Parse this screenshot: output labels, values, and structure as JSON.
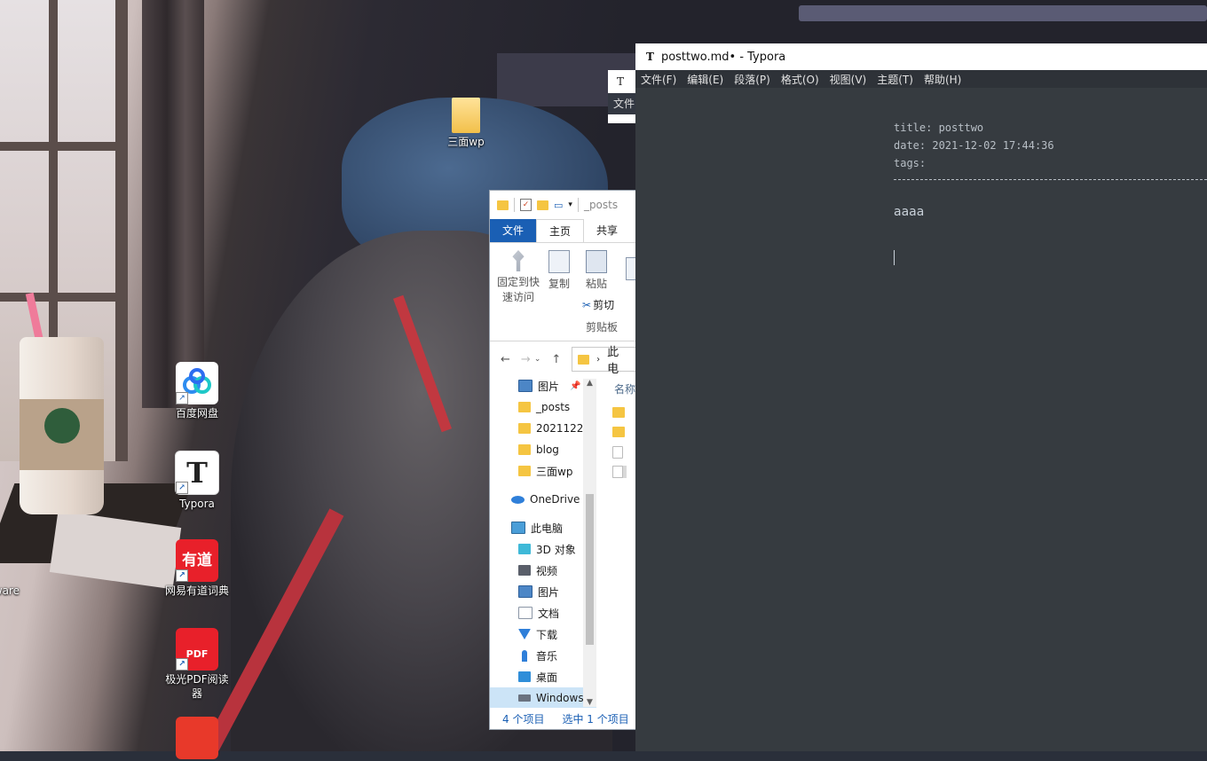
{
  "desktop": {
    "icons": [
      {
        "label": "三面wp",
        "icon": "folder-icon"
      },
      {
        "label": "百度网盘",
        "icon": "baidu-netdisk-icon"
      },
      {
        "label": "Typora",
        "icon": "typora-icon"
      },
      {
        "label": "网易有道词典",
        "icon": "youdao-dict-icon",
        "tile_text": "有道"
      },
      {
        "label": "极光PDF阅读器",
        "icon": "pdf-reader-icon",
        "tile_text": "PDF"
      },
      {
        "label": "ware",
        "icon": "app-icon"
      }
    ]
  },
  "bg_typora": {
    "logo": "T",
    "menu_label": "文件"
  },
  "explorer": {
    "quick_access_title": "_posts",
    "tabs": [
      "文件",
      "主页",
      "共享"
    ],
    "ribbon": {
      "pin_label_1": "固定到快",
      "pin_label_2": "速访问",
      "copy_label": "复制",
      "paste_label": "粘贴",
      "cut_label": "剪切",
      "group_label": "剪贴板"
    },
    "address_text": "此电",
    "nav_items": [
      {
        "label": "图片",
        "icon": "pictures-icon",
        "pinned": true
      },
      {
        "label": "_posts",
        "icon": "folder-icon"
      },
      {
        "label": "2021122",
        "icon": "folder-icon"
      },
      {
        "label": "blog",
        "icon": "folder-icon"
      },
      {
        "label": "三面wp",
        "icon": "folder-icon"
      },
      {
        "label": "OneDrive",
        "icon": "onedrive-icon"
      },
      {
        "label": "此电脑",
        "icon": "this-pc-icon"
      },
      {
        "label": "3D 对象",
        "icon": "3d-objects-icon"
      },
      {
        "label": "视频",
        "icon": "videos-icon"
      },
      {
        "label": "图片",
        "icon": "pictures-icon"
      },
      {
        "label": "文档",
        "icon": "documents-icon"
      },
      {
        "label": "下载",
        "icon": "downloads-icon"
      },
      {
        "label": "音乐",
        "icon": "music-icon"
      },
      {
        "label": "桌面",
        "icon": "desktop-icon"
      },
      {
        "label": "Windows",
        "icon": "windows-drive-icon",
        "selected": true
      }
    ],
    "column_header": "名称",
    "status_count": "4 个项目",
    "status_selected": "选中 1 个项目"
  },
  "typora": {
    "title": "posttwo.md• - Typora",
    "logo": "T",
    "menu": [
      "文件(F)",
      "编辑(E)",
      "段落(P)",
      "格式(O)",
      "视图(V)",
      "主题(T)",
      "帮助(H)"
    ],
    "front_matter": {
      "title": "title: posttwo",
      "date": "date: 2021-12-02 17:44:36",
      "tags": "tags:"
    },
    "paragraph": "aaaa"
  },
  "colors": {
    "typora_bg": "#363b40",
    "explorer_accent": "#1a5fb4",
    "folder": "#f5c542"
  }
}
